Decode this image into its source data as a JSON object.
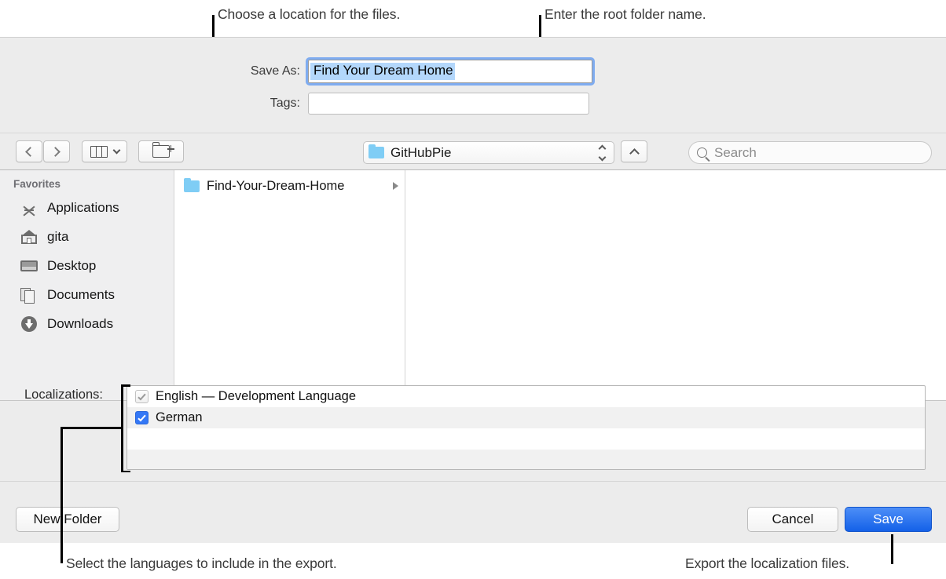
{
  "annotations": [
    {
      "id": "loc",
      "text": "Choose a location for the files."
    },
    {
      "id": "root",
      "text": "Enter the root folder name."
    },
    {
      "id": "langs",
      "text": "Select the languages to include in the export."
    },
    {
      "id": "export",
      "text": "Export the localization files."
    }
  ],
  "dialog": {
    "save_as": {
      "label": "Save As:",
      "value": "Find Your Dream Home",
      "selected": true
    },
    "tags": {
      "label": "Tags:",
      "value": "",
      "placeholder": ""
    },
    "toolbar": {
      "back_icon": "chevron-left-icon",
      "forward_icon": "chevron-right-icon",
      "view_icon": "column-view-icon",
      "view_chevron_icon": "chevron-down-icon",
      "new_folder_icon": "new-folder-icon",
      "path_popup": {
        "label": "GitHubPie",
        "folder_icon": "folder-icon",
        "stepper_icon": "up-down-stepper-icon"
      },
      "up_button_icon": "chevron-up-icon",
      "search": {
        "placeholder": "Search",
        "value": "",
        "icon": "search-icon"
      }
    },
    "sidebar": {
      "section_title": "Favorites",
      "items": [
        {
          "label": "Applications",
          "icon": "applications-icon"
        },
        {
          "label": "gita",
          "icon": "home-icon"
        },
        {
          "label": "Desktop",
          "icon": "desktop-icon"
        },
        {
          "label": "Documents",
          "icon": "documents-icon"
        },
        {
          "label": "Downloads",
          "icon": "downloads-icon"
        }
      ]
    },
    "browser": {
      "column_items": [
        {
          "label": "Find-Your-Dream-Home",
          "icon": "folder-icon",
          "has_children": true
        }
      ]
    },
    "localizations": {
      "label": "Localizations:",
      "rows": [
        {
          "label": "English — Development Language",
          "checked": true,
          "enabled": false
        },
        {
          "label": "German",
          "checked": true,
          "enabled": true
        },
        {
          "label": "",
          "checked": false,
          "enabled": true
        },
        {
          "label": "",
          "checked": false,
          "enabled": true
        }
      ]
    },
    "footer": {
      "new_folder_label": "New Folder",
      "cancel_label": "Cancel",
      "save_label": "Save"
    }
  },
  "colors": {
    "accent": "#1461e8",
    "selection": "#b3d7fb",
    "focus_ring": "#7facf0",
    "folder": "#7fcdf5",
    "checkbox_on": "#3478f6"
  }
}
